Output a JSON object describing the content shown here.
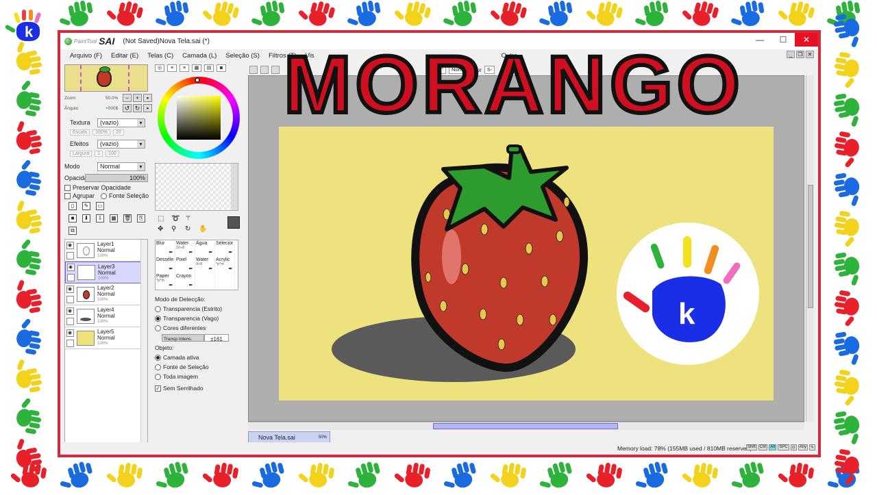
{
  "headline": "MORANGO",
  "colors": {
    "frame_border": "#d12a3c",
    "headline_fill": "#d01020",
    "artboard_bg": "#eee27f",
    "selection": "#d8d8ff"
  },
  "app": {
    "logo_small": "PaintTool",
    "logo_big": "SAI",
    "title": "(Not Saved)Nova Tela.sai (*)",
    "window_buttons": {
      "minimize": "—",
      "maximize": "☐",
      "close": "✕"
    }
  },
  "menu": [
    "Arquivo (F)",
    "Editar (E)",
    "Telas (C)",
    "Camada (L)",
    "Seleção (S)",
    "Filtros (T)",
    "Vis",
    "Outro"
  ],
  "navigator": {
    "zoom_label": "Zoom",
    "zoom_value": "50.0%",
    "angle_label": "Ângulo",
    "angle_value": "+000$"
  },
  "properties": {
    "texture_label": "Textura",
    "texture_value": "(vazio)",
    "texture_scale_label": "Escala",
    "texture_scale_value": "100%",
    "texture_strength": "20",
    "effects_label": "Efeitos",
    "effects_value": "(vazio)",
    "effects_width_label": "Largura",
    "effects_width_value": "1",
    "effects_strength": "100",
    "mode_label": "Modo",
    "mode_value": "Normal",
    "opacity_label": "Opacidade",
    "opacity_value": "100%",
    "preserve_opacity": "Preservar Opacidade",
    "group_label": "Agrupar",
    "selection_source": "Fonte Seleção"
  },
  "layers": [
    {
      "name": "Layer1",
      "mode": "Normal",
      "opacity": "100%",
      "selected": false
    },
    {
      "name": "Layer3",
      "mode": "Normal",
      "opacity": "100%",
      "selected": true
    },
    {
      "name": "Layer2",
      "mode": "Normal",
      "opacity": "100%",
      "selected": false
    },
    {
      "name": "Layer4",
      "mode": "Normal",
      "opacity": "100%",
      "selected": false
    },
    {
      "name": "Layer5",
      "mode": "Normal",
      "opacity": "100%",
      "selected": false
    }
  ],
  "brushes": [
    {
      "name": "Blur",
      "size": ""
    },
    {
      "name": "Water",
      "size": "10÷8"
    },
    {
      "name": "Água",
      "size": ""
    },
    {
      "name": "Selecior",
      "size": ""
    },
    {
      "name": "Desséle",
      "size": ""
    },
    {
      "name": "Pixel",
      "size": ""
    },
    {
      "name": "Water",
      "size": "9÷8"
    },
    {
      "name": "Acrylic",
      "size": "*p*m"
    },
    {
      "name": "Paper",
      "size": "*p*m"
    },
    {
      "name": "Crayon",
      "size": ""
    },
    {
      "name": "",
      "size": ""
    },
    {
      "name": "",
      "size": ""
    }
  ],
  "detection": {
    "title": "Modo de Detecção:",
    "options": [
      "Transparencia (Estrito)",
      "Transparencia (Vago)",
      "Cores diferentes"
    ],
    "selected_index": 1,
    "tolerance_label": "Transp Intens.",
    "tolerance_value": "±161",
    "object_title": "Objeto:",
    "object_options": [
      "Camada ativa",
      "Fonte de Seleção",
      "Toda imagem"
    ],
    "object_selected_index": 0,
    "antialias_label": "Sem Serrilhado"
  },
  "canvas_toolbar": {
    "angle": "0°",
    "blend": "Normal",
    "stab": "dor",
    "s": "S-"
  },
  "document_tab": {
    "name": "Nova Tela.sai",
    "zoom": "50%"
  },
  "status": {
    "memory": "Memory load: 78% (155MB used / 810MB reserved)",
    "keys": [
      "Shift",
      "Ctrl",
      "Alt",
      "SPC",
      "⊙",
      "Any",
      "✎"
    ]
  },
  "logo_letter": "k",
  "icons": [
    "strawberry-illustration",
    "hand-logo",
    "eye-icon",
    "new-layer-icon",
    "trash-icon",
    "color-wheel",
    "pen-icon"
  ]
}
